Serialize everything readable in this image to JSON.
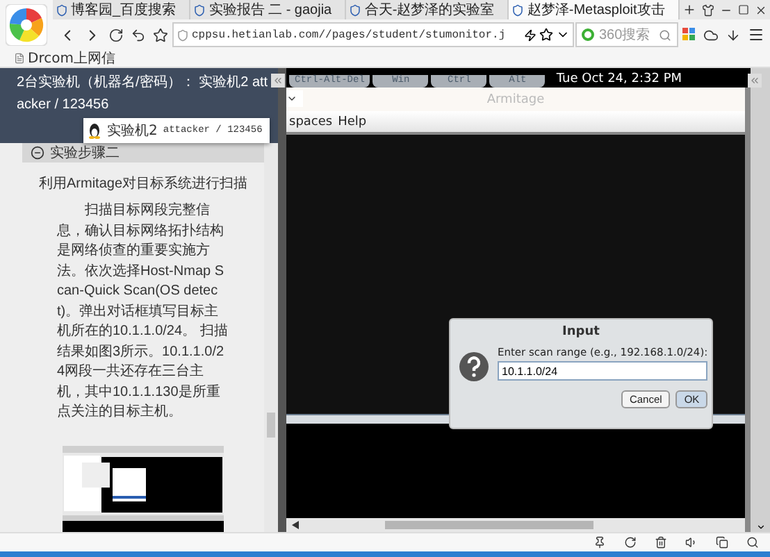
{
  "browser": {
    "tabs": [
      {
        "label": "博客园_百度搜索",
        "selected": false
      },
      {
        "label": "实验报告 二 - gaojia",
        "selected": false
      },
      {
        "label": "合天-赵梦泽的实验室",
        "selected": false
      },
      {
        "label": "赵梦泽-Metasploit攻击",
        "selected": true
      }
    ],
    "address": "cppsu.hetianlab.com//pages/student/stumonitor.j",
    "search": {
      "placeholder": "360搜索"
    },
    "bookmarks": [
      "Drcom上网信"
    ]
  },
  "lab_panel": {
    "machines_note": "2台实验机（机器名/密码）： 实验机2  attacker / 123456",
    "popup": {
      "machine": "实验机2",
      "credentials": "attacker / 123456"
    },
    "section_title": "实验步骤二",
    "expanded": true,
    "heading": "利用Armitage对目标系统进行扫描",
    "paragraph": "扫描目标网段完整信息，确认目标网络拓扑结构是网络侦查的重要实施方法。依次选择Host-Nmap Scan-Quick Scan(OS detect)。弹出对话框填写目标主机所在的10.1.1.0/24。 扫描结果如图3所示。10.1.1.0/24网段一共还存在三台主机，其中10.1.1.130是所重点关注的目标主机。"
  },
  "remote": {
    "keys": [
      "Ctrl-Alt-Del",
      "Win",
      "Ctrl",
      "Alt"
    ],
    "clock": "Tue Oct 24, 2:32 PM",
    "window_title": "Armitage",
    "menu": [
      "spaces",
      "Help"
    ],
    "dialog": {
      "title": "Input",
      "prompt": "Enter scan range (e.g., 192.168.1.0/24):",
      "value": "10.1.1.0/24",
      "buttons": [
        {
          "label": "Cancel",
          "default": false
        },
        {
          "label": "OK",
          "default": true
        }
      ]
    }
  }
}
